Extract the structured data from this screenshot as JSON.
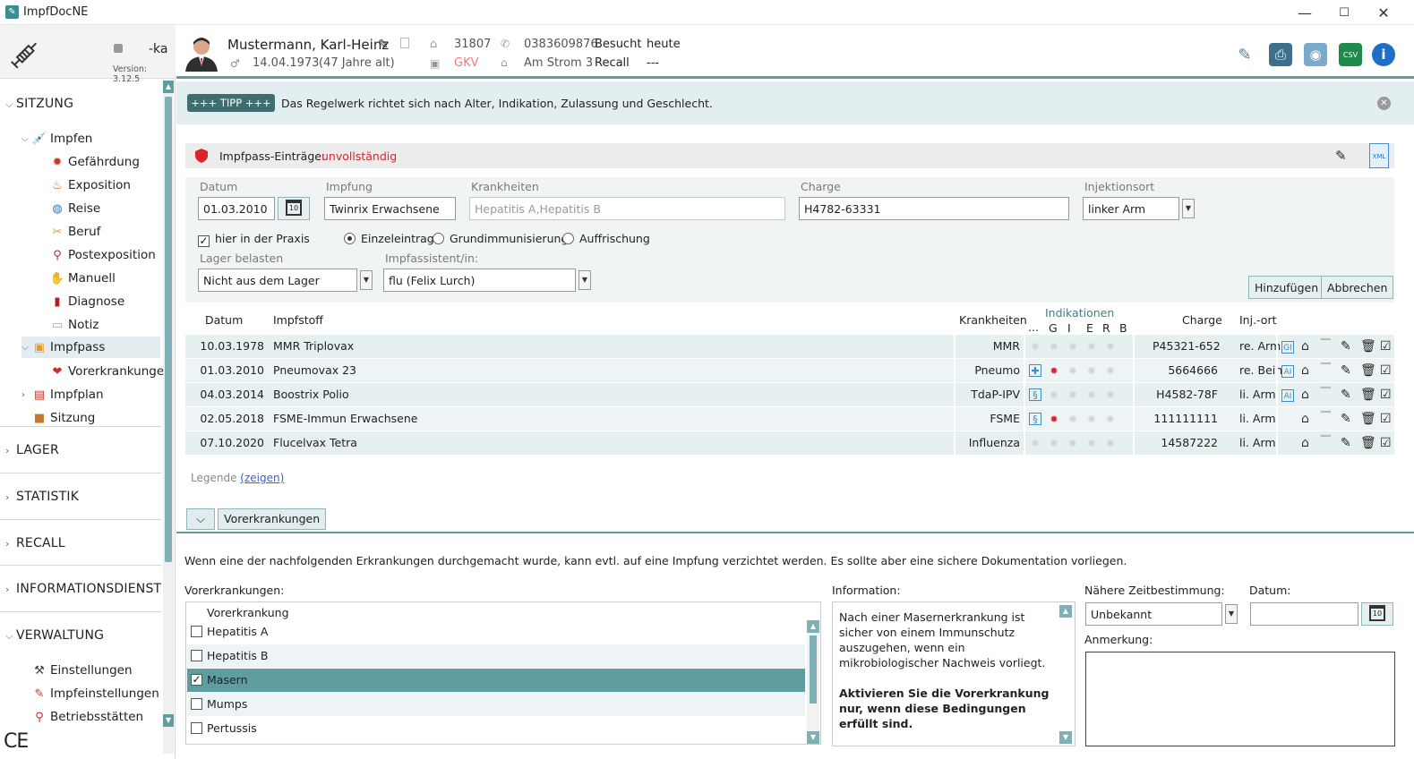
{
  "app": {
    "title": "ImpfDocNE"
  },
  "window": {
    "minimize": "—",
    "maximize": "☐",
    "close": "✕"
  },
  "sidebar": {
    "user": "-ka",
    "version": "Version: 3.12.5",
    "sections": {
      "sitzung": "SITZUNG",
      "lager": "LAGER",
      "statistik": "STATISTIK",
      "recall": "RECALL",
      "informationsdienst": "INFORMATIONSDIENST",
      "verwaltung": "VERWALTUNG"
    },
    "items": {
      "impfen": "Impfen",
      "gefaehrdung": "Gefährdung",
      "exposition": "Exposition",
      "reise": "Reise",
      "beruf": "Beruf",
      "postexposition": "Postexposition",
      "manuell": "Manuell",
      "diagnose": "Diagnose",
      "notiz": "Notiz",
      "impfpass": "Impfpass",
      "vorerkrankungen": "Vorerkrankungen",
      "impfplan": "Impfplan",
      "sitzung": "Sitzung",
      "einstellungen": "Einstellungen",
      "impfeinstellungen": "Impfeinstellungen",
      "betriebsstaetten": "Betriebsstätten"
    },
    "ce_mark": "CE"
  },
  "patient": {
    "name": "Mustermann, Karl-Heinz",
    "birth": "14.04.1973",
    "age": "(47 Jahre alt)",
    "id": "31807",
    "insurance": "GKV",
    "phone": "0383609876",
    "address": "Am Strom 3",
    "besucht_label": "Besucht",
    "besucht_value": "heute",
    "recall_label": "Recall",
    "recall_value": "---"
  },
  "tip": {
    "badge": "+++ TIPP +++",
    "text": "Das Regelwerk richtet sich nach Alter, Indikation, Zulassung und Geschlecht."
  },
  "passbar": {
    "label": "Impfpass-Einträge:",
    "status": "unvollständig",
    "xml": "XML"
  },
  "form": {
    "datum_label": "Datum",
    "datum_value": "01.03.2010",
    "impfung_label": "Impfung",
    "impfung_value": "Twinrix Erwachsene",
    "krankheiten_label": "Krankheiten",
    "krankheiten_value": "Hepatitis A,Hepatitis B",
    "charge_label": "Charge",
    "charge_value": "H4782-63331",
    "injektionsort_label": "Injektionsort",
    "injektionsort_value": "linker Arm",
    "praxis_label": "hier in der Praxis",
    "radio_einzel": "Einzeleintrag",
    "radio_grund": "Grundimmunisierung",
    "radio_auff": "Auffrischung",
    "lager_label": "Lager belasten",
    "lager_value": "Nicht aus dem Lager",
    "assistent_label": "Impfassistent/in:",
    "assistent_value": "flu (Felix Lurch)",
    "add_button": "Hinzufügen",
    "cancel_button": "Abbrechen",
    "calendar_day": "10"
  },
  "table": {
    "headers": {
      "datum": "Datum",
      "impfstoff": "Impfstoff",
      "krankheiten": "Krankheiten",
      "dots": "...",
      "indikationen": "Indikationen",
      "g": "G",
      "i": "I",
      "e": "E",
      "r": "R",
      "b": "B",
      "charge": "Charge",
      "injort": "Inj.-ort"
    },
    "rows": [
      {
        "datum": "10.03.1978",
        "impfstoff": "MMR Triplovax",
        "krankheiten": "MMR",
        "charge": "P45321-652",
        "ort": "re. Arm",
        "tag": "GI"
      },
      {
        "datum": "01.03.2010",
        "impfstoff": "Pneumovax 23",
        "krankheiten": "Pneumo",
        "charge": "5664666",
        "ort": "re. Bein",
        "tag": "AI"
      },
      {
        "datum": "04.03.2014",
        "impfstoff": "Boostrix Polio",
        "krankheiten": "TdaP-IPV",
        "charge": "H4582-78F",
        "ort": "li. Arm",
        "tag": "AI"
      },
      {
        "datum": "02.05.2018",
        "impfstoff": "FSME-Immun Erwachsene",
        "krankheiten": "FSME",
        "charge": "111111111",
        "ort": "li. Arm",
        "tag": ""
      },
      {
        "datum": "07.10.2020",
        "impfstoff": "Flucelvax Tetra",
        "krankheiten": "Influenza",
        "charge": "14587222",
        "ort": "li. Arm",
        "tag": ""
      }
    ]
  },
  "legend": {
    "label": "Legende",
    "link": "(zeigen)"
  },
  "bottom": {
    "tab": "Vorerkrankungen",
    "intro": "Wenn eine der nachfolgenden Erkrankungen durchgemacht wurde, kann evtl. auf eine Impfung verzichtet werden. Es sollte aber eine sichere Dokumentation vorliegen.",
    "list_label": "Vorerkrankungen:",
    "list_header": "Vorerkrankung",
    "list": [
      {
        "label": "Hepatitis A",
        "checked": false
      },
      {
        "label": "Hepatitis B",
        "checked": false
      },
      {
        "label": "Masern",
        "checked": true
      },
      {
        "label": "Mumps",
        "checked": false
      },
      {
        "label": "Pertussis",
        "checked": false
      }
    ],
    "info_label": "Information:",
    "info_text": "Nach einer Masernerkrankung ist sicher von einem Immunschutz auszugehen, wenn ein mikrobiologischer Nachweis vorliegt.",
    "info_bold": "Aktivieren Sie die Vorerkrankung nur, wenn diese Bedingungen erfüllt sind.",
    "zeit_label": "Nähere Zeitbestimmung:",
    "zeit_value": "Unbekannt",
    "datum_label": "Datum:",
    "datum_value": "",
    "anmerkung_label": "Anmerkung:",
    "anmerkung_value": ""
  },
  "colors": {
    "accent": "#5f9ea0",
    "warning": "#d9262c",
    "selected_row": "#5f9ea0"
  }
}
